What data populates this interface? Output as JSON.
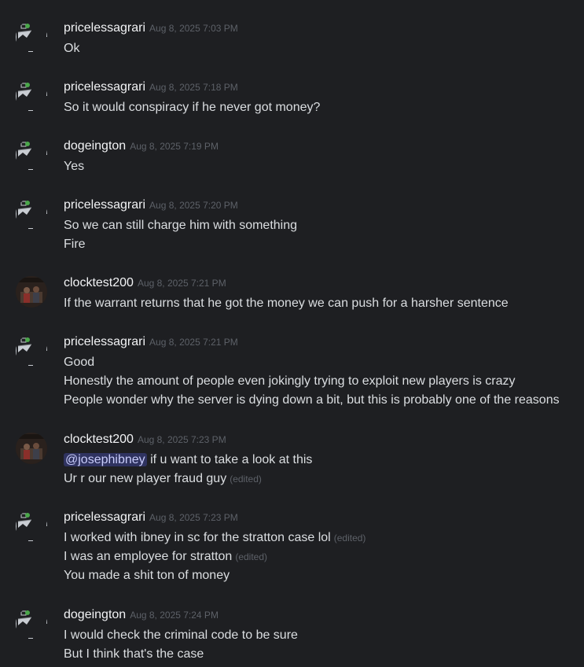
{
  "messages": [
    {
      "author": "pricelessagrari",
      "timestamp": "Aug 8, 2025 7:03 PM",
      "avatar": "broken-image-icon",
      "lines": [
        {
          "text": "Ok"
        }
      ]
    },
    {
      "author": "pricelessagrari",
      "timestamp": "Aug 8, 2025 7:18 PM",
      "avatar": "broken-image-icon",
      "lines": [
        {
          "text": "So it would conspiracy if he never got money?"
        }
      ]
    },
    {
      "author": "dogeington",
      "timestamp": "Aug 8, 2025 7:19 PM",
      "avatar": "broken-image-icon",
      "lines": [
        {
          "text": "Yes"
        }
      ]
    },
    {
      "author": "pricelessagrari",
      "timestamp": "Aug 8, 2025 7:20 PM",
      "avatar": "broken-image-icon",
      "lines": [
        {
          "text": "So we can still charge him with something"
        },
        {
          "text": "Fire"
        }
      ]
    },
    {
      "author": "clocktest200",
      "timestamp": "Aug 8, 2025 7:21 PM",
      "avatar": "user-photo-avatar",
      "lines": [
        {
          "text": "If the warrant returns that he got the money we can push for a harsher sentence"
        }
      ]
    },
    {
      "author": "pricelessagrari",
      "timestamp": "Aug 8, 2025 7:21 PM",
      "avatar": "broken-image-icon",
      "lines": [
        {
          "text": "Good"
        },
        {
          "text": "Honestly the amount of people even jokingly trying to exploit new players is crazy"
        },
        {
          "text": "People wonder why the server is dying down a bit, but this is probably one of the reasons"
        }
      ]
    },
    {
      "author": "clocktest200",
      "timestamp": "Aug 8, 2025 7:23 PM",
      "avatar": "user-photo-avatar",
      "lines": [
        {
          "mention": "@josephibney",
          "text": " if u want to take a look at this"
        },
        {
          "text": "Ur r our new player fraud guy",
          "edited": "(edited)"
        }
      ]
    },
    {
      "author": "pricelessagrari",
      "timestamp": "Aug 8, 2025 7:23 PM",
      "avatar": "broken-image-icon",
      "lines": [
        {
          "text": "I worked with ibney in sc for the stratton case lol",
          "edited": "(edited)"
        },
        {
          "text": "I was an employee for stratton",
          "edited": "(edited)"
        },
        {
          "text": "You made a shit ton of money"
        }
      ]
    },
    {
      "author": "dogeington",
      "timestamp": "Aug 8, 2025 7:24 PM",
      "avatar": "broken-image-icon",
      "lines": [
        {
          "text": "I would check the criminal code to be sure"
        },
        {
          "text": "But I think that's the case"
        }
      ]
    }
  ]
}
